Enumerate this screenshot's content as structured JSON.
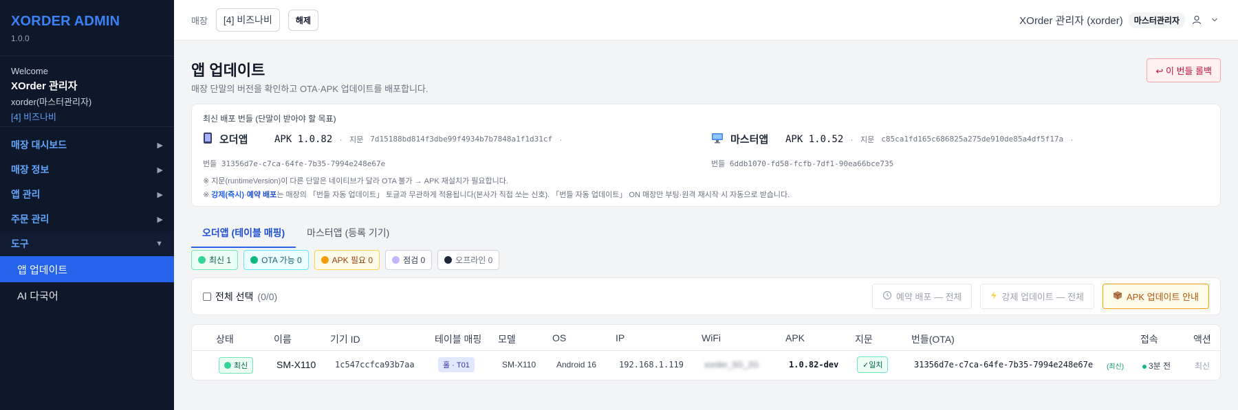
{
  "sidebar": {
    "brand": "XORDER ADMIN",
    "version": "1.0.0",
    "welcome": "Welcome",
    "user_name": "XOrder 관리자",
    "user_id": "xorder(마스터관리자)",
    "store": "[4] 비즈나비",
    "menu": [
      {
        "label": "매장 대시보드",
        "arrow": "▶"
      },
      {
        "label": "매장 정보",
        "arrow": "▶"
      },
      {
        "label": "앱 관리",
        "arrow": "▶"
      },
      {
        "label": "주문 관리",
        "arrow": "▶"
      },
      {
        "label": "도구",
        "arrow": "▼"
      }
    ],
    "sub_items": [
      {
        "label": "앱 업데이트"
      },
      {
        "label": "AI 다국어"
      }
    ]
  },
  "topbar": {
    "store_label": "매장",
    "store_value": "[4] 비즈나비",
    "release": "해제",
    "admin": "XOrder 관리자 (xorder)",
    "role": "마스터관리자"
  },
  "page": {
    "title": "앱 업데이트",
    "description": "매장 단말의 버전을 확인하고 OTA·APK 업데이트를 배포합니다.",
    "rollback": "↩ 이 번들 롤백"
  },
  "bundle": {
    "heading": "최신 배포 번들 (단말이 받아야 할 목표)",
    "order_app": {
      "name": "오더앱",
      "apk": "APK 1.0.82",
      "fp_label": "지문",
      "fp": "7d15188bd814f3dbe99f4934b7b7848a1f1d31cf",
      "bundle": "번들 31356d7e-c7ca-64fe-7b35-7994e248e67e"
    },
    "master_app": {
      "name": "마스터앱",
      "apk": "APK 1.0.52",
      "fp_label": "지문",
      "fp": "c85ca1fd165c686825a275de910de85a4df5f17a",
      "bundle": "번들 6ddb1070-fd58-fcfb-7df1-90ea66bce735"
    },
    "note1": "※ 지문(runtimeVersion)이 다른 단말은 네이티브가 달라 OTA 불가 → APK 재설치가 필요합니다.",
    "note2_prefix": "※ ",
    "note2_b1": "강제(즉시)",
    "note2_mid": "·",
    "note2_b2": "예약 배포",
    "note2_rest": "는 매장의 「번들 자동 업데이트」 토글과 무관하게 적용됩니다(본사가 직접 쏘는 신호). 「번들 자동 업데이트」 ON 매장만 부팅·원격 재시작 시 자동으로 받습니다."
  },
  "tabs": [
    {
      "label": "오더앱 (테이블 매핑)"
    },
    {
      "label": "마스터앱 (등록 기기)"
    }
  ],
  "filters": [
    {
      "label": "최신 1",
      "color": "#34d399"
    },
    {
      "label": "OTA 가능 0",
      "color": "#10b981"
    },
    {
      "label": "APK 필요 0",
      "color": "#f59e0b"
    },
    {
      "label": "점검 0",
      "color": "#c4b5fd"
    },
    {
      "label": "오프라인 0",
      "color": "#1f2937"
    }
  ],
  "actions": {
    "select_all": "전체 선택",
    "select_count": "(0/0)",
    "schedule": "예약 배포 — 전체",
    "force": "강제 업데이트 — 전체",
    "apk_guide": "APK 업데이트 안내"
  },
  "table": {
    "headers": [
      "상태",
      "이름",
      "기기 ID",
      "테이블 매핑",
      "모델",
      "OS",
      "IP",
      "WiFi",
      "APK",
      "지문",
      "번들(OTA)",
      "접속",
      "액션"
    ],
    "rows": [
      {
        "status": "최신",
        "name": "SM-X110",
        "device_id": "1c547ccfca93b7aa",
        "mapping": "홀 · T01",
        "model": "SM-X110",
        "os": "Android 16",
        "ip": "192.168.1.119",
        "wifi": "xorder_5G_2G",
        "apk": "1.0.82-dev",
        "fingerprint": "✓일치",
        "bundle": "31356d7e-c7ca-64fe-7b35-7994e248e67e",
        "bundle_tag": "(최신)",
        "access": "3분 전",
        "action": "최신"
      }
    ]
  }
}
